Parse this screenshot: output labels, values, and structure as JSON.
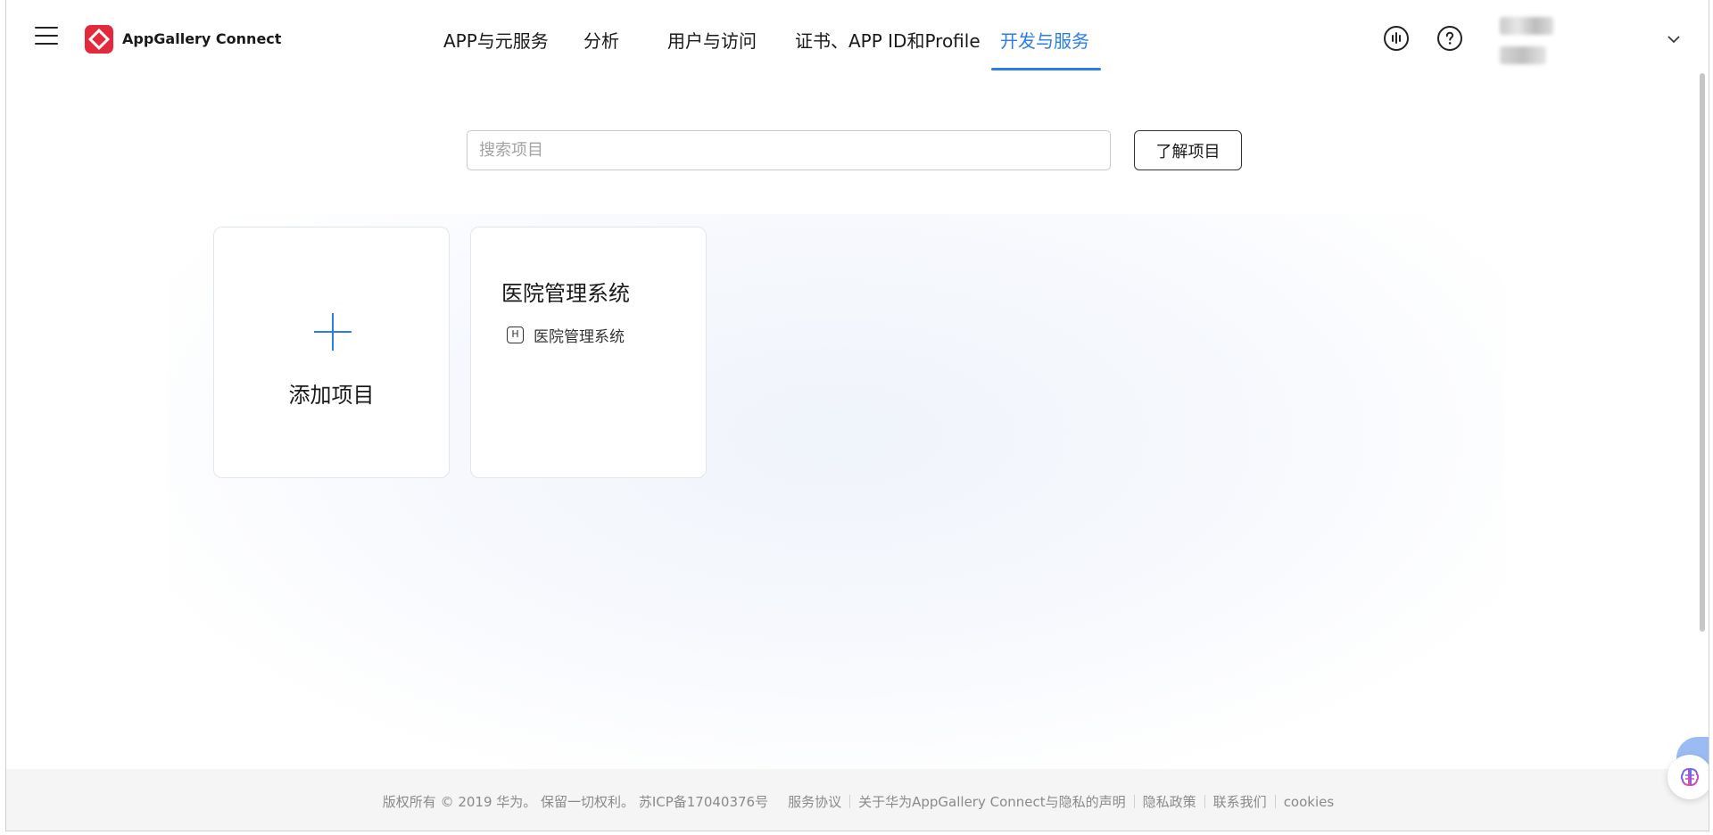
{
  "header": {
    "app_title": "AppGallery Connect",
    "nav": [
      {
        "label": "APP与元服务"
      },
      {
        "label": "分析"
      },
      {
        "label": "用户与访问"
      },
      {
        "label": "证书、APP ID和Profile"
      },
      {
        "label": "开发与服务",
        "active": true
      }
    ],
    "icons": [
      "hamburger-menu-icon",
      "appgallery-logo-icon",
      "voice-wave-icon",
      "help-icon",
      "chevron-down-icon"
    ]
  },
  "search": {
    "placeholder": "搜索项目",
    "learn_label": "了解项目"
  },
  "cards": {
    "add_label": "添加项目",
    "project": {
      "title": "医院管理系统",
      "badge": "H",
      "subtitle": "医院管理系统"
    }
  },
  "footer": {
    "copyright": "版权所有 © 2019 华为。 保留一切权利。 苏ICP备17040376号",
    "links": [
      "服务协议",
      "关于华为AppGallery Connect与隐私的声明",
      "隐私政策",
      "联系我们",
      "cookies"
    ]
  },
  "colors": {
    "accent": "#2b7de9",
    "logo": "#e3293c",
    "footer_bg": "#f5f5f5"
  }
}
